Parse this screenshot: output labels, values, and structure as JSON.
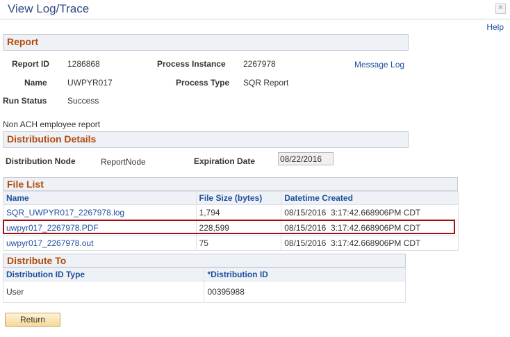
{
  "window": {
    "title": "View Log/Trace",
    "close_glyph": "✕",
    "help_label": "Help"
  },
  "report": {
    "section_title": "Report",
    "report_id_label": "Report ID",
    "report_id": "1286868",
    "process_instance_label": "Process Instance",
    "process_instance": "2267978",
    "message_log_label": "Message Log",
    "name_label": "Name",
    "name": "UWPYR017",
    "process_type_label": "Process Type",
    "process_type": "SQR Report",
    "run_status_label": "Run Status",
    "run_status": "Success",
    "description": "Non ACH employee report"
  },
  "distribution_details": {
    "section_title": "Distribution Details",
    "node_label": "Distribution Node",
    "node": "ReportNode",
    "expiration_label": "Expiration Date",
    "expiration": "08/22/2016"
  },
  "file_list": {
    "section_title": "File List",
    "columns": [
      "Name",
      "File Size (bytes)",
      "Datetime Created"
    ],
    "rows": [
      {
        "name": "SQR_UWPYR017_2267978.log",
        "size": "1,794",
        "created": "08/15/2016  3:17:42.668906PM CDT"
      },
      {
        "name": "uwpyr017_2267978.PDF",
        "size": "228,599",
        "created": "08/15/2016  3:17:42.668906PM CDT"
      },
      {
        "name": "uwpyr017_2267978.out",
        "size": "75",
        "created": "08/15/2016  3:17:42.668906PM CDT"
      }
    ],
    "highlight_color": "#a50e0e"
  },
  "distribute_to": {
    "section_title": "Distribute To",
    "columns": [
      "Distribution ID Type",
      "*Distribution ID"
    ],
    "rows": [
      {
        "type": "User",
        "id": "00395988"
      }
    ]
  },
  "actions": {
    "return_label": "Return"
  },
  "colors": {
    "section_title": "#b24a0b",
    "link": "#1f4fa0",
    "header_bg": "#eef1f5"
  }
}
